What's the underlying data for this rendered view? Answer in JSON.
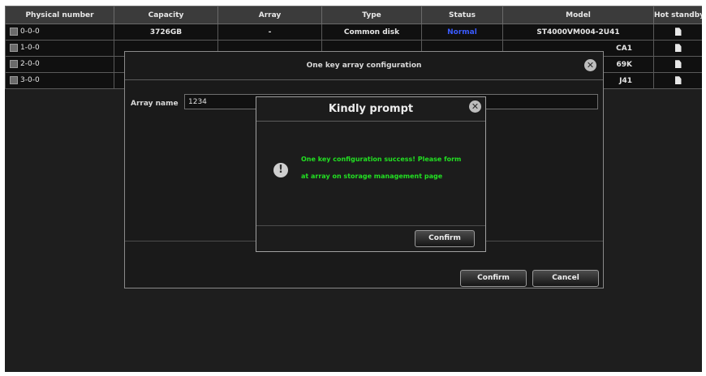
{
  "table": {
    "headers": [
      "Physical number",
      "Capacity",
      "Array",
      "Type",
      "Status",
      "Model",
      "Hot standby"
    ],
    "rows": [
      {
        "number": "0-0-0",
        "capacity": "3726GB",
        "array": "-",
        "type": "Common disk",
        "status": "Normal",
        "model": "ST4000VM004-2U41"
      },
      {
        "number": "1-0-0",
        "model_tail": "CA1"
      },
      {
        "number": "2-0-0",
        "model_tail": "69K"
      },
      {
        "number": "3-0-0",
        "model_tail": "J41"
      }
    ]
  },
  "array_dialog": {
    "title": "One key array configuration",
    "array_name_label": "Array name",
    "array_name_value": "1234",
    "confirm_label": "Confirm",
    "cancel_label": "Cancel"
  },
  "prompt_dialog": {
    "title": "Kindly prompt",
    "message_line1": "One key configuration success! Please form",
    "message_line2": "at array on storage management page",
    "confirm_label": "Confirm"
  },
  "icons": {
    "close": "close-icon",
    "warning": "warning-icon",
    "disk": "disk-icon",
    "checkbox": "checkbox"
  },
  "colors": {
    "status_normal": "#3a5bff",
    "prompt_text": "#22e022",
    "background": "#1e1e1e"
  }
}
